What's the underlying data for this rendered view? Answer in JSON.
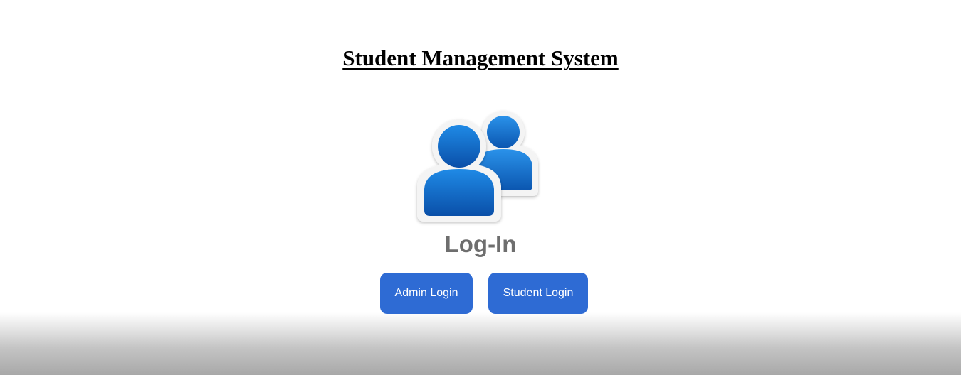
{
  "header": {
    "title": "Student Management System"
  },
  "login": {
    "icon": "users-icon",
    "heading": "Log-In",
    "admin_button_label": "Admin Login",
    "student_button_label": "Student Login"
  },
  "colors": {
    "button_background": "#2e6bd4",
    "icon_blue": "#0a63c7",
    "heading_gray": "#6e6e6e"
  }
}
